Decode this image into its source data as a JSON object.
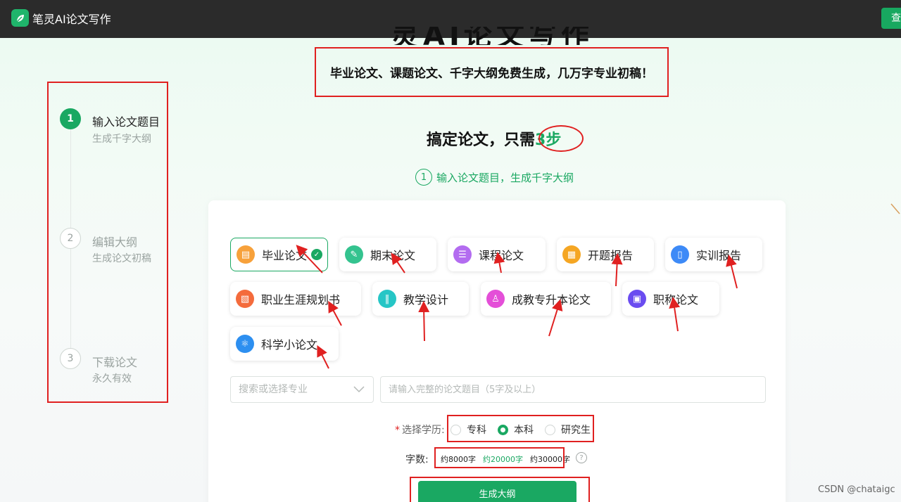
{
  "app": {
    "title": "笔灵AI论文写作",
    "top_button": "查"
  },
  "hero": {
    "title_cut": "灵AI论文写作",
    "slogan": "毕业论文、课题论文、千字大纲免费生成，几万字专业初稿！"
  },
  "steps": [
    {
      "num": "1",
      "title": "输入论文题目",
      "sub": "生成千字大纲"
    },
    {
      "num": "2",
      "title": "编辑大纲",
      "sub": "生成论文初稿"
    },
    {
      "num": "3",
      "title": "下载论文",
      "sub": "永久有效"
    }
  ],
  "headline": {
    "prefix": "搞定论文，只需",
    "highlight": "3步"
  },
  "current_step": {
    "num": "1",
    "text": "输入论文题目，生成千字大纲"
  },
  "paper_types": [
    {
      "label": "毕业论文",
      "icon": "book-icon",
      "color": "#f7a13b"
    },
    {
      "label": "期末论文",
      "icon": "pen-icon",
      "color": "#34c38f"
    },
    {
      "label": "课程论文",
      "icon": "list-icon",
      "color": "#b36cf0"
    },
    {
      "label": "开题报告",
      "icon": "report-icon",
      "color": "#f5a623"
    },
    {
      "label": "实训报告",
      "icon": "document-icon",
      "color": "#3d8af7"
    },
    {
      "label": "职业生涯规划书",
      "icon": "plan-icon",
      "color": "#f46b3c"
    },
    {
      "label": "教学设计",
      "icon": "teaching-icon",
      "color": "#26c6c6"
    },
    {
      "label": "成教专升本论文",
      "icon": "graduate-icon",
      "color": "#e44fd8"
    },
    {
      "label": "职称论文",
      "icon": "certificate-icon",
      "color": "#6a4cf0"
    },
    {
      "label": "科学小论文",
      "icon": "atom-icon",
      "color": "#2d8ff0"
    }
  ],
  "selected_type": "毕业论文",
  "form": {
    "major_placeholder": "搜索或选择专业",
    "topic_placeholder": "请输入完整的论文题目（5字及以上）",
    "edu_label": "选择学历:",
    "edu_required": "*",
    "edu_options": [
      "专科",
      "本科",
      "研究生"
    ],
    "edu_selected": "本科",
    "wordcount_label": "字数:",
    "wordcount_options": [
      "约8000字",
      "约20000字",
      "约30000字"
    ],
    "wordcount_selected": "约20000字",
    "help": "?",
    "submit": "生成大纲"
  },
  "watermark": "CSDN @chataigc",
  "colors": {
    "accent": "#1aa862",
    "annotation": "#e02020",
    "topbar": "#2b2b2b"
  }
}
